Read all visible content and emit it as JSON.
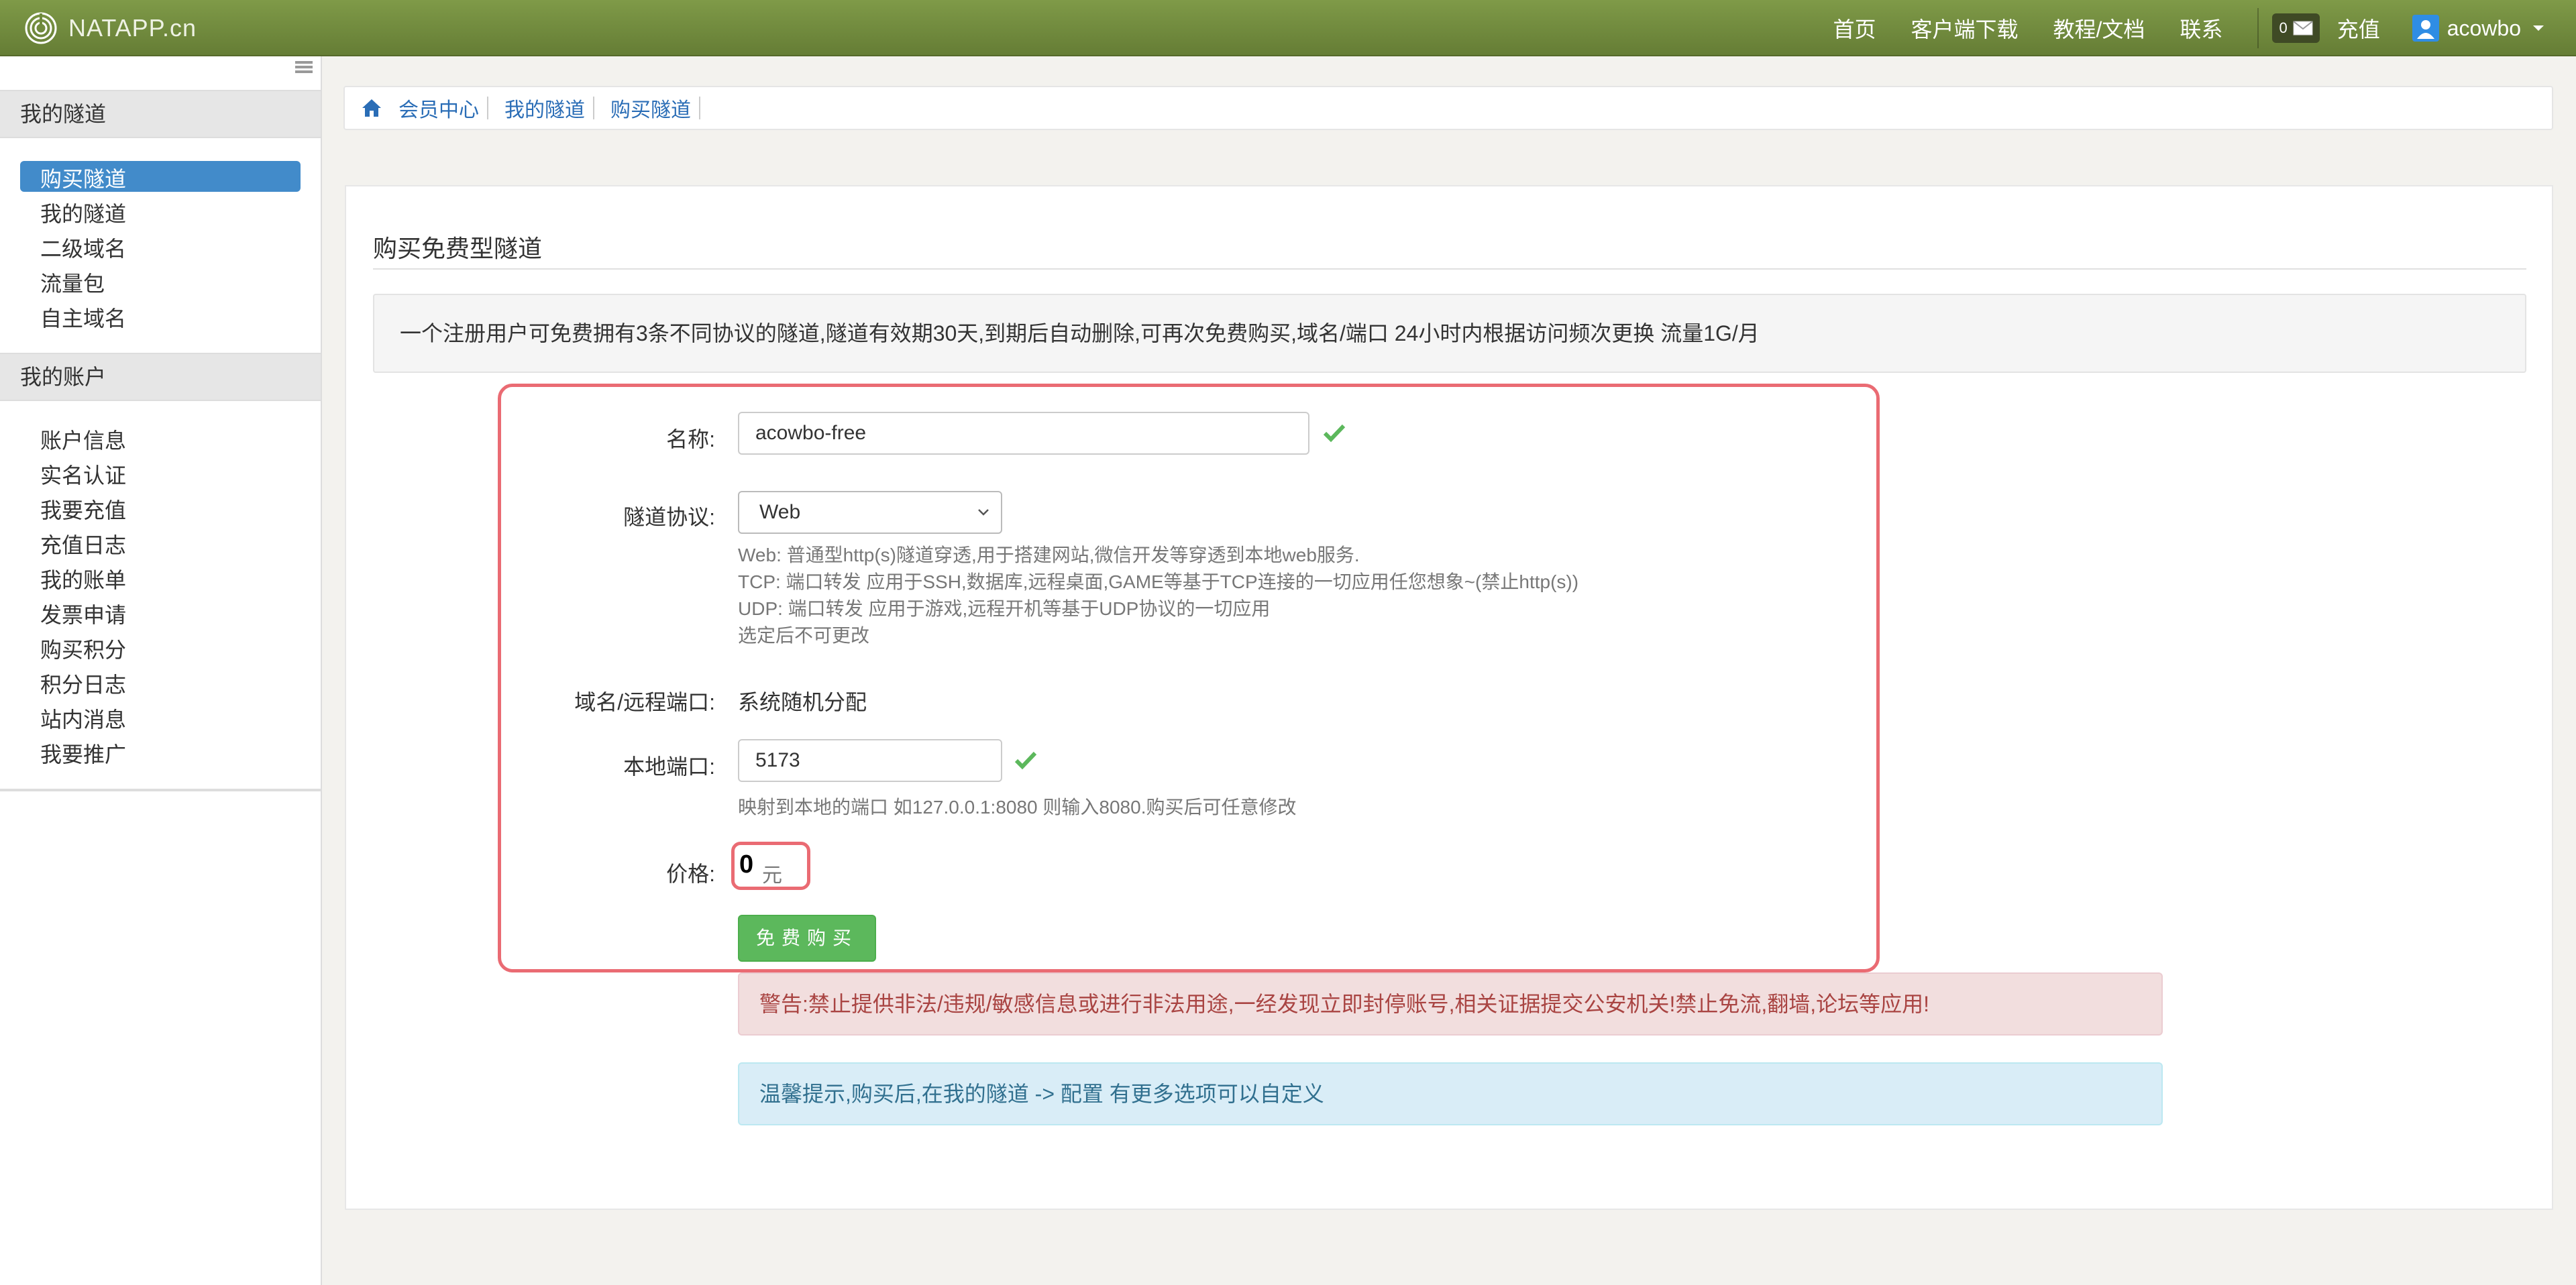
{
  "navbar": {
    "brand": "NATAPP.cn",
    "links": [
      "首页",
      "客户端下载",
      "教程/文档",
      "联系"
    ],
    "message_count": "0",
    "recharge": "充值",
    "username": "acowbo"
  },
  "sidebar": {
    "group1_title": "我的隧道",
    "group1_items": [
      "购买隧道",
      "我的隧道",
      "二级域名",
      "流量包",
      "自主域名"
    ],
    "group2_title": "我的账户",
    "group2_items": [
      "账户信息",
      "实名认证",
      "我要充值",
      "充值日志",
      "我的账单",
      "发票申请",
      "购买积分",
      "积分日志",
      "站内消息",
      "我要推广"
    ]
  },
  "breadcrumb": [
    "会员中心",
    "我的隧道",
    "购买隧道"
  ],
  "main": {
    "title": "购买免费型隧道",
    "info": "一个注册用户可免费拥有3条不同协议的隧道,隧道有效期30天,到期后自动删除,可再次免费购买,域名/端口 24小时内根据访问频次更换 流量1G/月",
    "form": {
      "name_label": "名称:",
      "name_value": "acowbo-free",
      "protocol_label": "隧道协议:",
      "protocol_value": "Web",
      "protocol_help": [
        "Web: 普通型http(s)隧道穿透,用于搭建网站,微信开发等穿透到本地web服务.",
        "TCP: 端口转发 应用于SSH,数据库,远程桌面,GAME等基于TCP连接的一切应用任您想象~(禁止http(s))",
        "UDP: 端口转发 应用于游戏,远程开机等基于UDP协议的一切应用",
        "选定后不可更改"
      ],
      "domain_label": "域名/远程端口:",
      "domain_value": "系统随机分配",
      "port_label": "本地端口:",
      "port_value": "5173",
      "port_help": "映射到本地的端口 如127.0.0.1:8080 则输入8080.购买后可任意修改",
      "price_label": "价格:",
      "price_value": "0",
      "price_unit": "元",
      "buy_button": "免费购买"
    },
    "warning": "警告:禁止提供非法/违规/敏感信息或进行非法用途,一经发现立即封停账号,相关证据提交公安机关!禁止免流,翻墙,论坛等应用!",
    "tip": "温馨提示,购买后,在我的隧道 -> 配置 有更多选项可以自定义"
  },
  "colors": {
    "navbar": "#6f8a3e",
    "active_item": "#428bca",
    "success": "#5cb85c",
    "highlight": "#ea6b73"
  }
}
